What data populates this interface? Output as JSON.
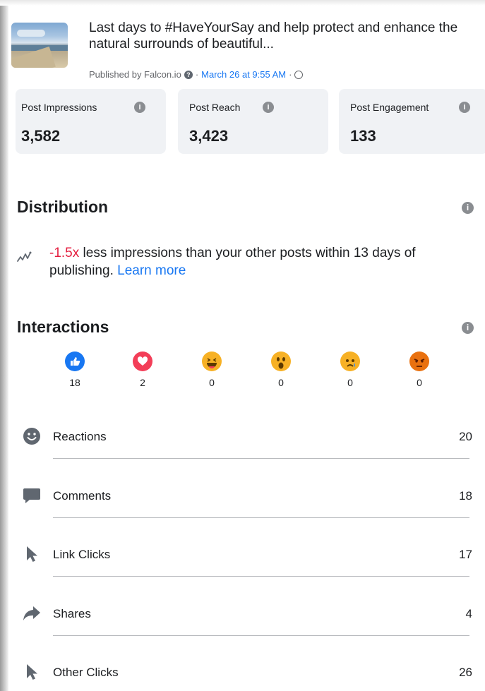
{
  "post": {
    "title": "Last days to #HaveYourSay and help protect and enhance the natural surrounds of beautiful...",
    "published_by": "Published by Falcon.io",
    "separator": "·",
    "date": "March 26 at 9:55 AM"
  },
  "metrics": [
    {
      "label": "Post Impressions",
      "value": "3,582"
    },
    {
      "label": "Post Reach",
      "value": "3,423"
    },
    {
      "label": "Post Engagement",
      "value": "133"
    }
  ],
  "distribution": {
    "title": "Distribution",
    "multiplier": "-1.5x",
    "text": " less impressions than your other posts within 13 days of publishing.",
    "link": "Learn more"
  },
  "interactions": {
    "title": "Interactions",
    "reactions": [
      {
        "icon": "like-icon",
        "count": "18",
        "color": "#1877f2"
      },
      {
        "icon": "love-icon",
        "count": "2",
        "color": "#f33e58"
      },
      {
        "icon": "haha-icon",
        "count": "0",
        "color": "#f7b125"
      },
      {
        "icon": "wow-icon",
        "count": "0",
        "color": "#f7b125"
      },
      {
        "icon": "sad-icon",
        "count": "0",
        "color": "#f7b125"
      },
      {
        "icon": "angry-icon",
        "count": "0",
        "color": "#e9710f"
      }
    ],
    "rows": [
      {
        "icon": "smiley-icon",
        "label": "Reactions",
        "value": "20"
      },
      {
        "icon": "comment-icon",
        "label": "Comments",
        "value": "18"
      },
      {
        "icon": "cursor-icon",
        "label": "Link Clicks",
        "value": "17"
      },
      {
        "icon": "share-icon",
        "label": "Shares",
        "value": "4"
      },
      {
        "icon": "cursor-icon",
        "label": "Other Clicks",
        "value": "26"
      }
    ]
  }
}
